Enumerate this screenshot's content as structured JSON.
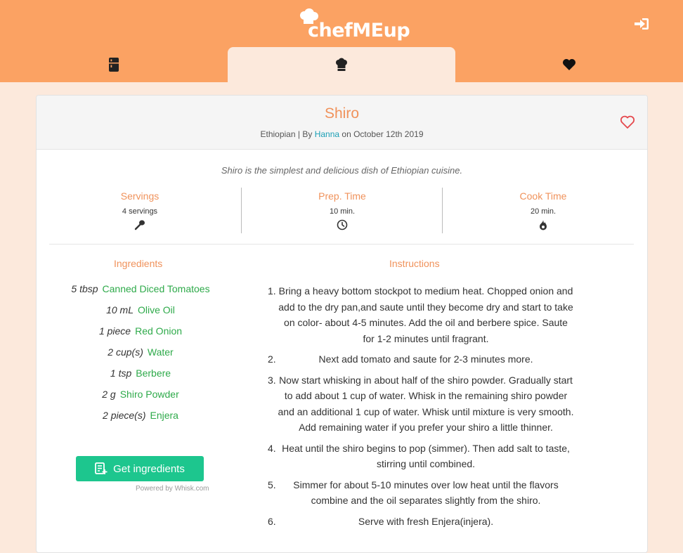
{
  "app": {
    "name": "chefMEup"
  },
  "nav": {
    "tabs": [
      {
        "icon": "fridge-icon"
      },
      {
        "icon": "chef-hat-icon",
        "active": true
      },
      {
        "icon": "heart-icon"
      }
    ],
    "login_icon": "sign-in-icon"
  },
  "recipe": {
    "title": "Shiro",
    "cuisine": "Ethiopian",
    "by_prefix": "| By",
    "author": "Hanna",
    "date_text": "on October 12th 2019",
    "description": "Shiro is the simplest and delicious dish of Ethiopian cuisine.",
    "favorite_icon": "heart-outline-icon"
  },
  "stats": [
    {
      "label": "Servings",
      "value": "4 servings",
      "icon": "spoon-icon"
    },
    {
      "label": "Prep. Time",
      "value": "10 min.",
      "icon": "clock-icon"
    },
    {
      "label": "Cook Time",
      "value": "20 min.",
      "icon": "fire-icon"
    }
  ],
  "ingredients": {
    "title": "Ingredients",
    "items": [
      {
        "qty": "5 tbsp",
        "name": "Canned Diced Tomatoes"
      },
      {
        "qty": "10 mL",
        "name": "Olive Oil"
      },
      {
        "qty": "1 piece",
        "name": "Red Onion"
      },
      {
        "qty": "2 cup(s)",
        "name": "Water"
      },
      {
        "qty": "1 tsp",
        "name": "Berbere"
      },
      {
        "qty": "2 g",
        "name": "Shiro Powder"
      },
      {
        "qty": "2 piece(s)",
        "name": "Enjera"
      }
    ],
    "button_label": "Get ingredients",
    "powered_by": "Powered by Whisk.com"
  },
  "instructions": {
    "title": "Instructions",
    "steps": [
      {
        "num": "1.",
        "text": "Bring a heavy bottom stockpot to medium heat. Chopped onion and add to the dry pan,and saute until they become dry and start to take on color- about 4-5 minutes. Add the oil and berbere spice. Saute for 1-2 minutes until fragrant."
      },
      {
        "num": "2.",
        "text": "Next add tomato and saute for 2-3 minutes more."
      },
      {
        "num": "3.",
        "text": "Now start whisking in about half of the shiro powder. Gradually start to add about 1 cup of water. Whisk in the remaining shiro powder and an additional 1 cup of water. Whisk until mixture is very smooth. Add remaining water if you prefer your shiro a little thinner."
      },
      {
        "num": "4.",
        "text": "Heat until the shiro begins to pop (simmer). Then add salt to taste, stirring until combined."
      },
      {
        "num": "5.",
        "text": "Simmer for about 5-10 minutes over low heat until the flavors combine and the oil separates slightly from the shiro."
      },
      {
        "num": "6.",
        "text": "Serve with fresh Enjera(injera)."
      }
    ]
  },
  "colors": {
    "header": "#fba263",
    "page_bg": "#fce9dc",
    "accent": "#f0925b",
    "link": "#1b9fb5",
    "ingredient": "#2eaa4a",
    "button": "#1dc68e"
  }
}
